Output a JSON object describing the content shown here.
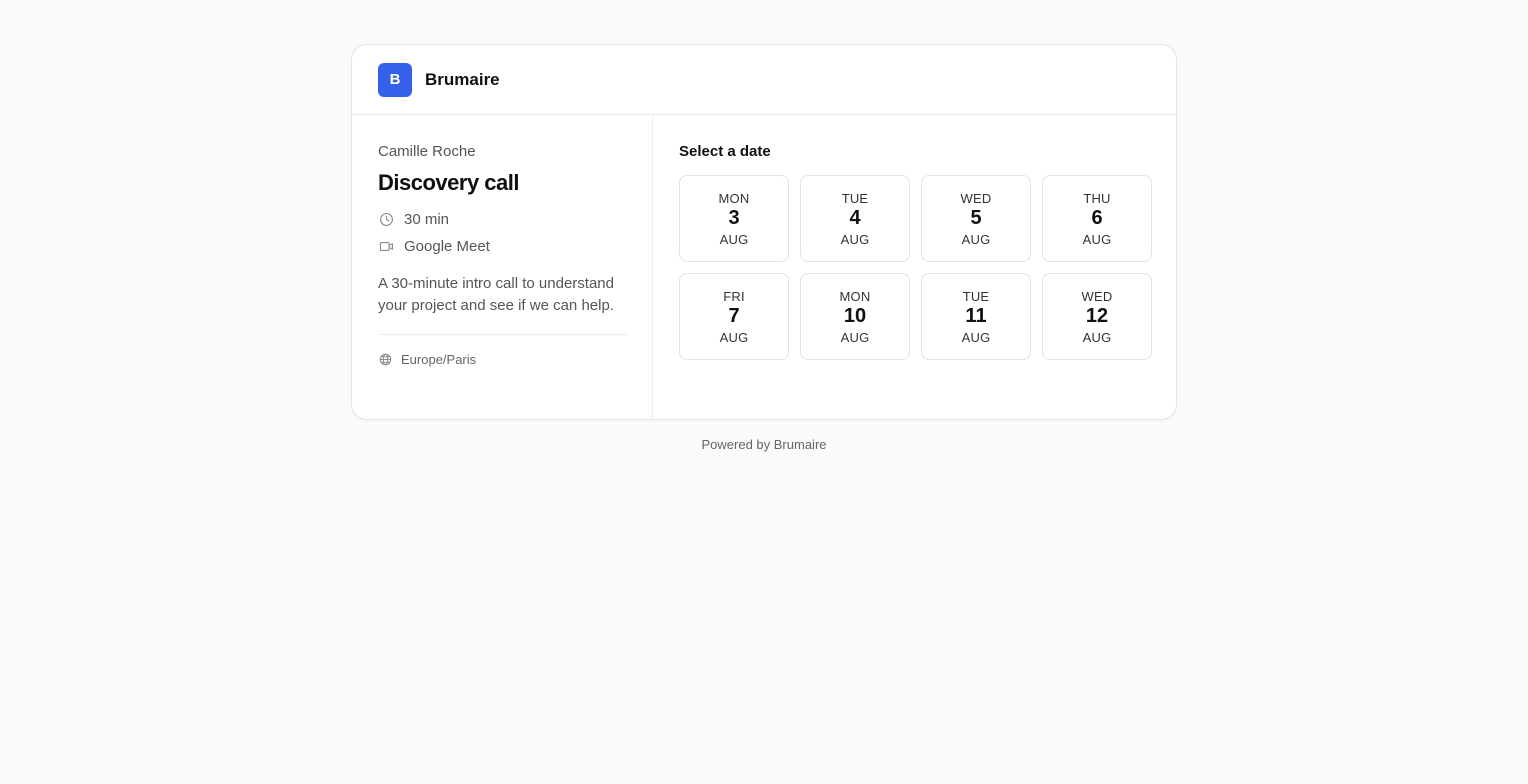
{
  "brand": {
    "logo_letter": "B",
    "name": "Brumaire",
    "accent": "#3461e8"
  },
  "event": {
    "host": "Camille Roche",
    "title": "Discovery call",
    "duration": "30 min",
    "location": "Google Meet",
    "description": "A 30-minute intro call to understand your project and see if we can help.",
    "timezone": "Europe/Paris"
  },
  "picker": {
    "label": "Select a date",
    "dates": [
      {
        "dow": "MON",
        "day": "3",
        "month": "AUG"
      },
      {
        "dow": "TUE",
        "day": "4",
        "month": "AUG"
      },
      {
        "dow": "WED",
        "day": "5",
        "month": "AUG"
      },
      {
        "dow": "THU",
        "day": "6",
        "month": "AUG"
      },
      {
        "dow": "FRI",
        "day": "7",
        "month": "AUG"
      },
      {
        "dow": "MON",
        "day": "10",
        "month": "AUG"
      },
      {
        "dow": "TUE",
        "day": "11",
        "month": "AUG"
      },
      {
        "dow": "WED",
        "day": "12",
        "month": "AUG"
      }
    ]
  },
  "footer": {
    "text": "Powered by Brumaire"
  },
  "icons": {
    "duration": "clock-icon",
    "location": "video-icon",
    "timezone": "globe-icon"
  }
}
